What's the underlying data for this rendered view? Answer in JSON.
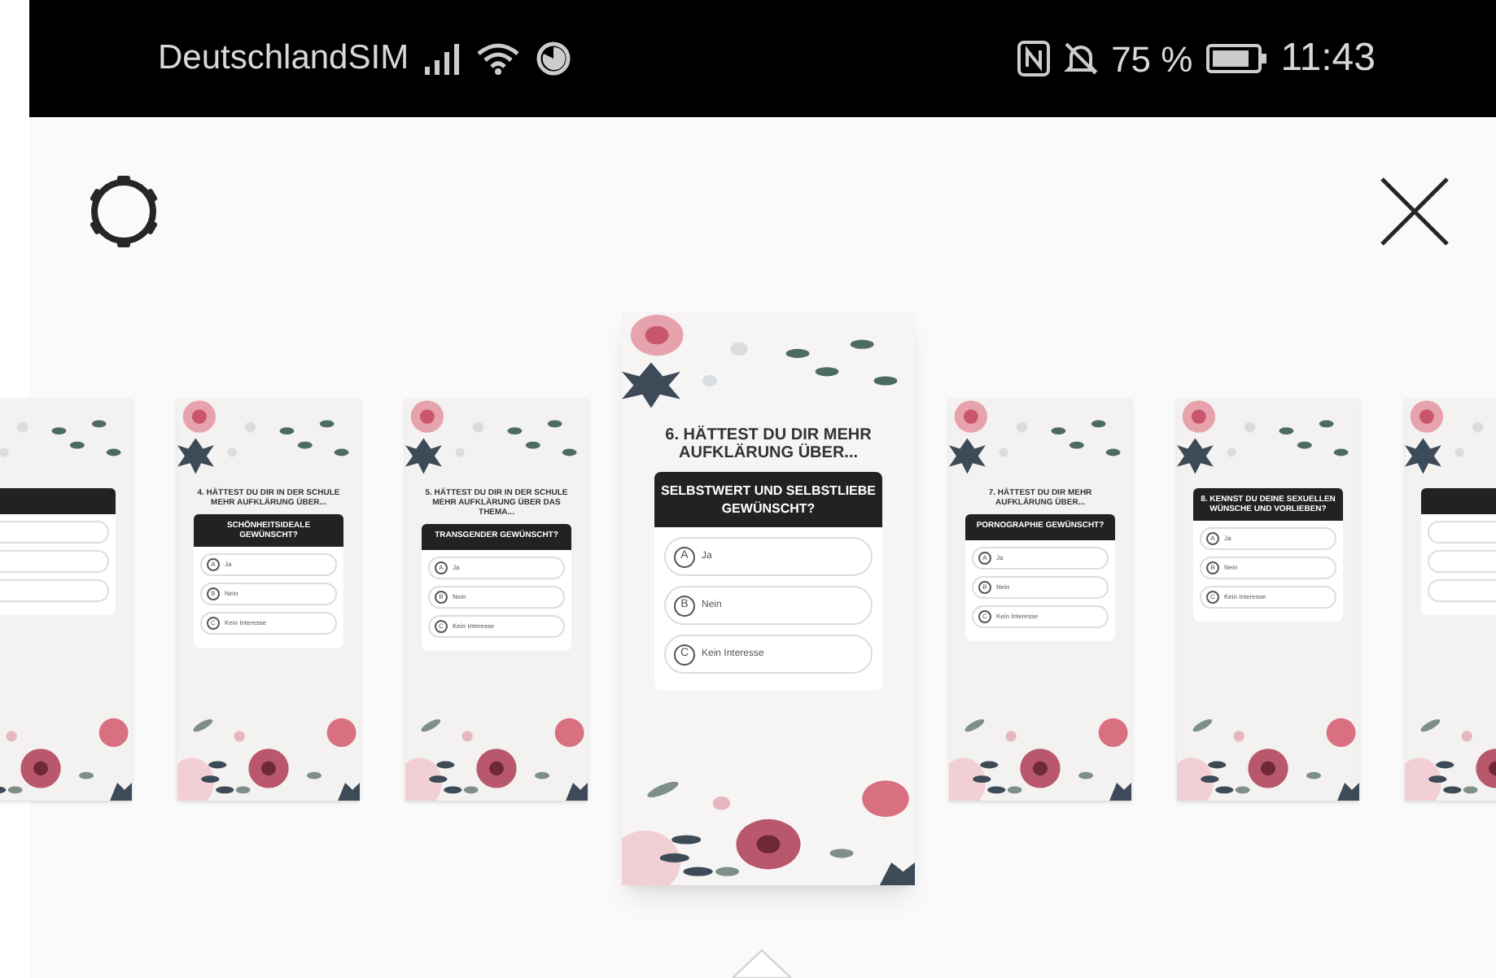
{
  "status_bar": {
    "carrier": "DeutschlandSIM",
    "battery": "75 %",
    "time": "11:43"
  },
  "cards": [
    {
      "selected": false,
      "kind": "partial"
    },
    {
      "selected": false,
      "title": "4. HÄTTEST DU DIR IN DER SCHULE MEHR AUFKLÄRUNG ÜBER...",
      "question": "SCHÖNHEITSIDEALE GEWÜNSCHT?",
      "options": [
        {
          "letter": "A",
          "text": "Ja"
        },
        {
          "letter": "B",
          "text": "Nein"
        },
        {
          "letter": "C",
          "text": "Kein Interesse"
        }
      ]
    },
    {
      "selected": false,
      "title": "5. HÄTTEST DU DIR IN DER SCHULE MEHR AUFKLÄRUNG ÜBER DAS THEMA...",
      "question": "TRANSGENDER GEWÜNSCHT?",
      "options": [
        {
          "letter": "A",
          "text": "Ja"
        },
        {
          "letter": "B",
          "text": "Nein"
        },
        {
          "letter": "C",
          "text": "Kein Interesse"
        }
      ]
    },
    {
      "selected": true,
      "title": "6. HÄTTEST DU DIR MEHR AUFKLÄRUNG ÜBER...",
      "question": "SELBSTWERT UND SELBSTLIEBE GEWÜNSCHT?",
      "options": [
        {
          "letter": "A",
          "text": "Ja"
        },
        {
          "letter": "B",
          "text": "Nein"
        },
        {
          "letter": "C",
          "text": "Kein Interesse"
        }
      ]
    },
    {
      "selected": false,
      "title": "7. HÄTTEST DU DIR MEHR AUFKLÄRUNG ÜBER...",
      "question": "PORNOGRAPHIE GEWÜNSCHT?",
      "options": [
        {
          "letter": "A",
          "text": "Ja"
        },
        {
          "letter": "B",
          "text": "Nein"
        },
        {
          "letter": "C",
          "text": "Kein Interesse"
        }
      ]
    },
    {
      "selected": false,
      "question": "8. KENNST DU DEINE SEXUELLEN WÜNSCHE UND VORLIEBEN?",
      "options": [
        {
          "letter": "A",
          "text": "Ja"
        },
        {
          "letter": "B",
          "text": "Nein"
        },
        {
          "letter": "C",
          "text": "Kein Interesse"
        }
      ]
    },
    {
      "selected": false,
      "kind": "partial"
    }
  ]
}
